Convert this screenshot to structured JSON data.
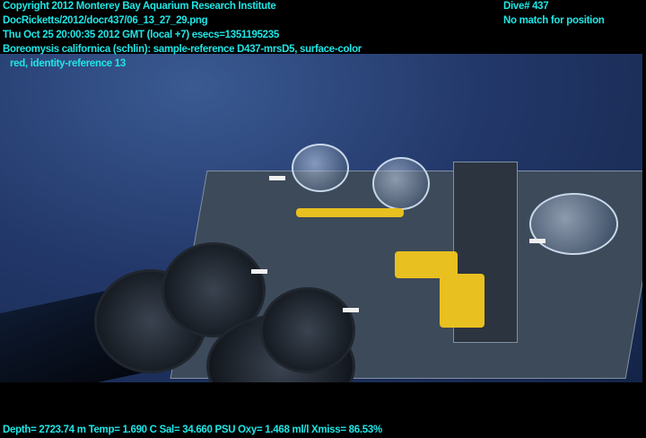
{
  "header": {
    "copyright": "Copyright 2012 Monterey Bay Aquarium Research Institute",
    "file": "DocRicketts/2012/docr437/06_13_27_29.png",
    "timestamp": "Thu Oct 25 20:00:35 2012 GMT (local +7)  esecs=1351195235",
    "annotation_line1": "Boreomysis californica (schlin): sample-reference D437-mrsD5, surface-color",
    "annotation_line2": "red, identity-reference 13",
    "dive": "Dive# 437",
    "position": "No match for position"
  },
  "footer": {
    "telemetry": "Depth= 2723.74 m  Temp= 1.690 C  Sal= 34.660 PSU  Oxy= 1.468 ml/l  Xmiss= 86.53%"
  }
}
